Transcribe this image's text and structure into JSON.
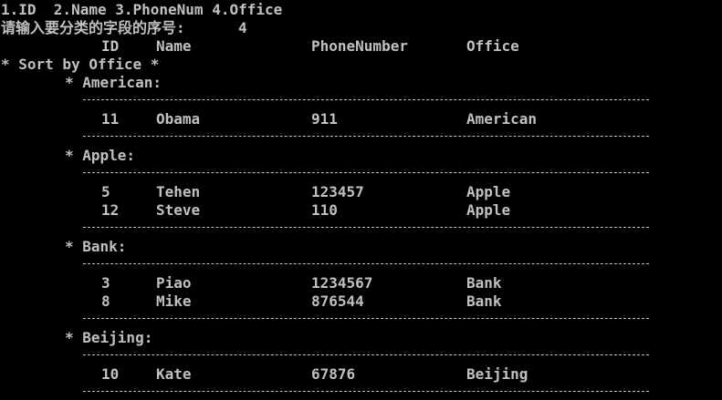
{
  "terminal": {
    "menu_line": "1.ID  2.Name 3.PhoneNum 4.Office",
    "prompt_text": "请输入要分类的字段的序号:",
    "prompt_value": "4",
    "headers": [
      "ID",
      "Name",
      "PhoneNumber",
      "Office"
    ],
    "sort_title": "* Sort by Office *",
    "groups": [
      {
        "label": "* American:",
        "rows": [
          [
            "11",
            "Obama",
            "911",
            "American"
          ]
        ]
      },
      {
        "label": "* Apple:",
        "rows": [
          [
            "5",
            "Tehen",
            "123457",
            "Apple"
          ],
          [
            "12",
            "Steve",
            "110",
            "Apple"
          ]
        ]
      },
      {
        "label": "* Bank:",
        "rows": [
          [
            "3",
            "Piao",
            "1234567",
            "Bank"
          ],
          [
            "8",
            "Mike",
            "876544",
            "Bank"
          ]
        ]
      },
      {
        "label": "* Beijing:",
        "rows": [
          [
            "10",
            "Kate",
            "67876",
            "Beijing"
          ]
        ]
      }
    ]
  },
  "colors": {
    "background": "#000000",
    "text": "#c0c0c0"
  }
}
